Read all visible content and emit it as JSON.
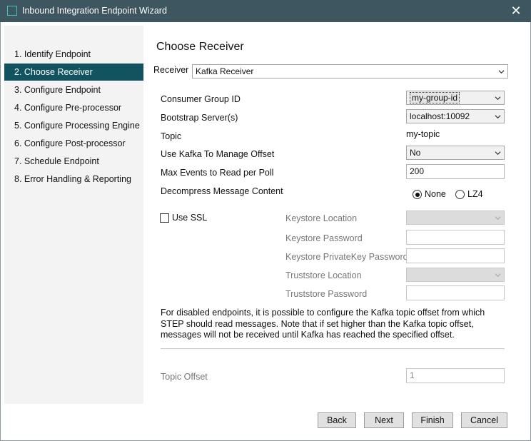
{
  "window": {
    "title": "Inbound Integration Endpoint Wizard",
    "close_glyph": "✕"
  },
  "sidebar": {
    "items": [
      {
        "label": "1. Identify Endpoint",
        "active": false
      },
      {
        "label": "2. Choose Receiver",
        "active": true
      },
      {
        "label": "3. Configure Endpoint",
        "active": false
      },
      {
        "label": "4. Configure Pre-processor",
        "active": false
      },
      {
        "label": "5. Configure Processing Engine",
        "active": false
      },
      {
        "label": "6. Configure Post-processor",
        "active": false
      },
      {
        "label": "7. Schedule Endpoint",
        "active": false
      },
      {
        "label": "8. Error Handling & Reporting",
        "active": false
      }
    ]
  },
  "main": {
    "heading": "Choose Receiver",
    "receiver_label": "Receiver",
    "receiver_value": "Kafka Receiver",
    "fields": {
      "consumer_group_label": "Consumer Group ID",
      "consumer_group_value": "my-group-id",
      "bootstrap_label": "Bootstrap Server(s)",
      "bootstrap_value": "localhost:10092",
      "topic_label": "Topic",
      "topic_value": "my-topic",
      "manage_offset_label": "Use Kafka To Manage Offset",
      "manage_offset_value": "No",
      "max_events_label": "Max Events to Read per Poll",
      "max_events_value": "200",
      "decompress_label": "Decompress Message Content",
      "decompress_options": [
        "None",
        "LZ4"
      ],
      "decompress_selected": "None"
    },
    "ssl": {
      "use_ssl_label": "Use SSL",
      "keystore_location_label": "Keystore Location",
      "keystore_password_label": "Keystore Password",
      "keystore_privatekey_label": "Keystore PrivateKey Password",
      "truststore_location_label": "Truststore Location",
      "truststore_password_label": "Truststore Password"
    },
    "info_text": "For disabled endpoints, it is possible to configure the Kafka topic offset from which STEP should read messages. Note that if set higher than the Kafka topic offset, messages will not be received until Kafka has reached the specified offset.",
    "topic_offset_label": "Topic Offset",
    "topic_offset_value": "1"
  },
  "buttons": {
    "back": "Back",
    "next": "Next",
    "finish": "Finish",
    "cancel": "Cancel"
  },
  "colors": {
    "titlebar": "#3e5660",
    "active_nav": "#11535e",
    "sidebar_bg": "#f3f3f3"
  },
  "icons": {
    "app": "window-icon",
    "close": "close-icon",
    "dropdown": "chevron-down-icon"
  }
}
